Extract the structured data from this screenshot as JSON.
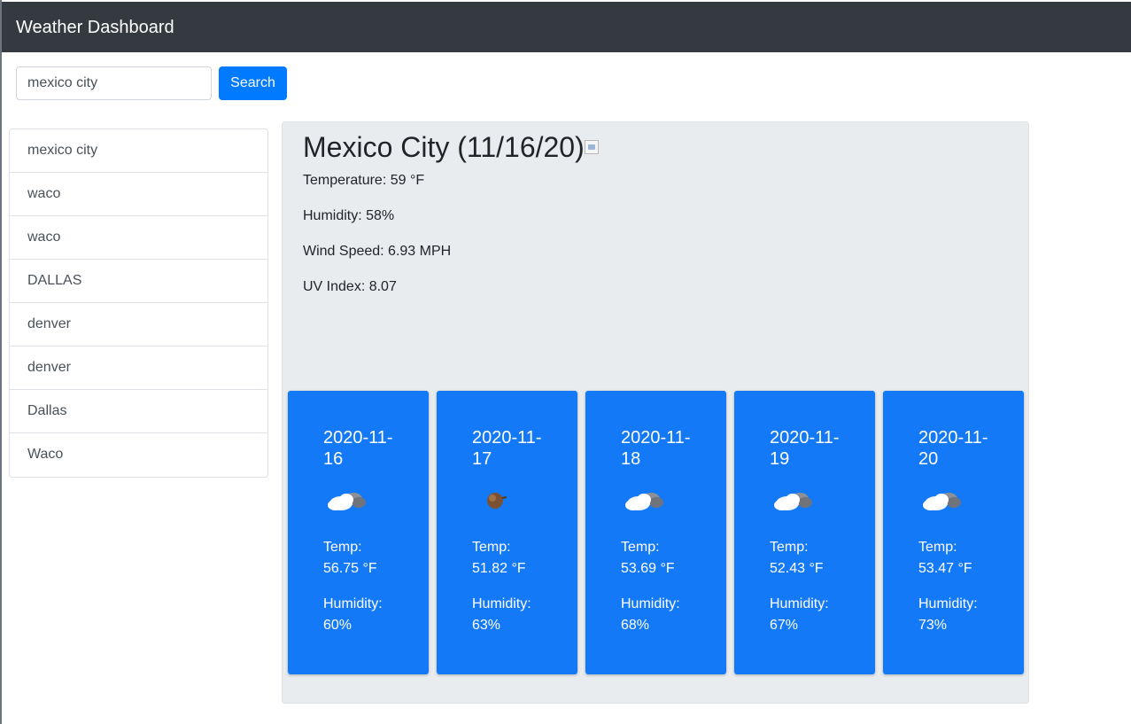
{
  "navbar": {
    "title": "Weather Dashboard"
  },
  "search": {
    "value": "mexico city",
    "button_label": "Search"
  },
  "history": [
    "mexico city",
    "waco",
    "waco",
    "DALLAS",
    "denver",
    "denver",
    "Dallas",
    "Waco"
  ],
  "current": {
    "title": "Mexico City (11/16/20)",
    "temperature": "Temperature: 59 °F",
    "humidity": "Humidity: 58%",
    "wind": "Wind Speed: 6.93 MPH",
    "uv": "UV Index: 8.07"
  },
  "forecast": [
    {
      "date": "2020-11-16",
      "icon": "cloud-icon",
      "temp_label": "Temp:",
      "temp": "56.75 °F",
      "humidity_label": "Humidity:",
      "humidity": "60%"
    },
    {
      "date": "2020-11-17",
      "icon": "dark-cloud-icon",
      "temp_label": "Temp:",
      "temp": "51.82 °F",
      "humidity_label": "Humidity:",
      "humidity": "63%"
    },
    {
      "date": "2020-11-18",
      "icon": "cloud-icon",
      "temp_label": "Temp:",
      "temp": "53.69 °F",
      "humidity_label": "Humidity:",
      "humidity": "68%"
    },
    {
      "date": "2020-11-19",
      "icon": "cloud-icon",
      "temp_label": "Temp:",
      "temp": "52.43 °F",
      "humidity_label": "Humidity:",
      "humidity": "67%"
    },
    {
      "date": "2020-11-20",
      "icon": "cloud-icon",
      "temp_label": "Temp:",
      "temp": "53.47 °F",
      "humidity_label": "Humidity:",
      "humidity": "73%"
    }
  ],
  "colors": {
    "navbar": "#343a40",
    "accent": "#007bff",
    "card": "#1479f7",
    "panel": "#e9ecef"
  }
}
